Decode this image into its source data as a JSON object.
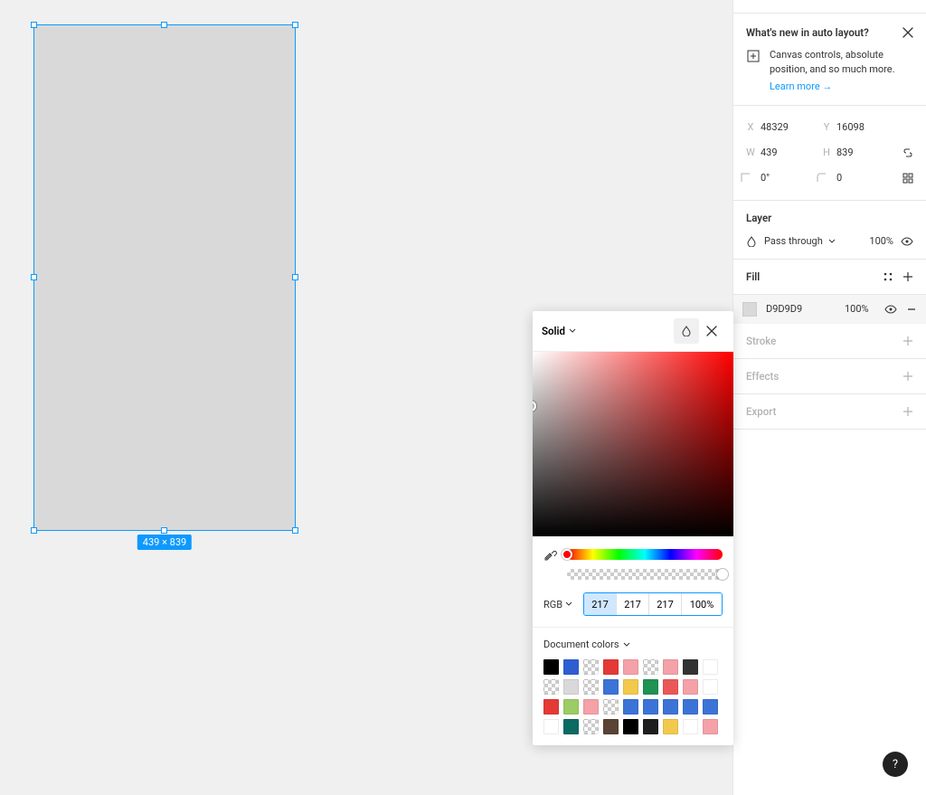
{
  "canvas": {
    "selection_size_label": "439 × 839"
  },
  "whats_new": {
    "title": "What's new in auto layout?",
    "body": "Canvas controls, absolute position, and so much more.",
    "learn_more": "Learn more →"
  },
  "position": {
    "x_label": "X",
    "x_value": "48329",
    "y_label": "Y",
    "y_value": "16098",
    "w_label": "W",
    "w_value": "439",
    "h_label": "H",
    "h_value": "839",
    "rot_value": "0°",
    "radius_value": "0"
  },
  "layer": {
    "title": "Layer",
    "blend_mode": "Pass through",
    "opacity": "100%"
  },
  "fill": {
    "title": "Fill",
    "hex": "D9D9D9",
    "opacity": "100%"
  },
  "stroke": {
    "title": "Stroke"
  },
  "effects": {
    "title": "Effects"
  },
  "export": {
    "title": "Export"
  },
  "picker": {
    "mode_label": "Solid",
    "rgb_label": "RGB",
    "r": "217",
    "g": "217",
    "b": "217",
    "a": "100%",
    "doc_colors_title": "Document colors",
    "swatches": [
      "#000000",
      "#2e5fd1",
      "checker",
      "#e53935",
      "#f4a1a8",
      "checker",
      "#f4a1a8",
      "#333333",
      "#ffffff",
      "checker",
      "#d9d9d9",
      "checker",
      "#3b74d6",
      "#f2c94c",
      "#1f9254",
      "#eb5757",
      "#f4a1a8",
      "#ffffff",
      "#e53935",
      "#9ccc65",
      "#f4a1a8",
      "checker",
      "#3b74d6",
      "#3b74d6",
      "#3b74d6",
      "#3b74d6",
      "#3b74d6",
      "#ffffff",
      "#0b6b63",
      "checker",
      "#5a4334",
      "#000000",
      "#1e1e1e",
      "#f2c94c",
      "#ffffff",
      "#f4a1a8"
    ]
  },
  "help": {
    "label": "?"
  }
}
